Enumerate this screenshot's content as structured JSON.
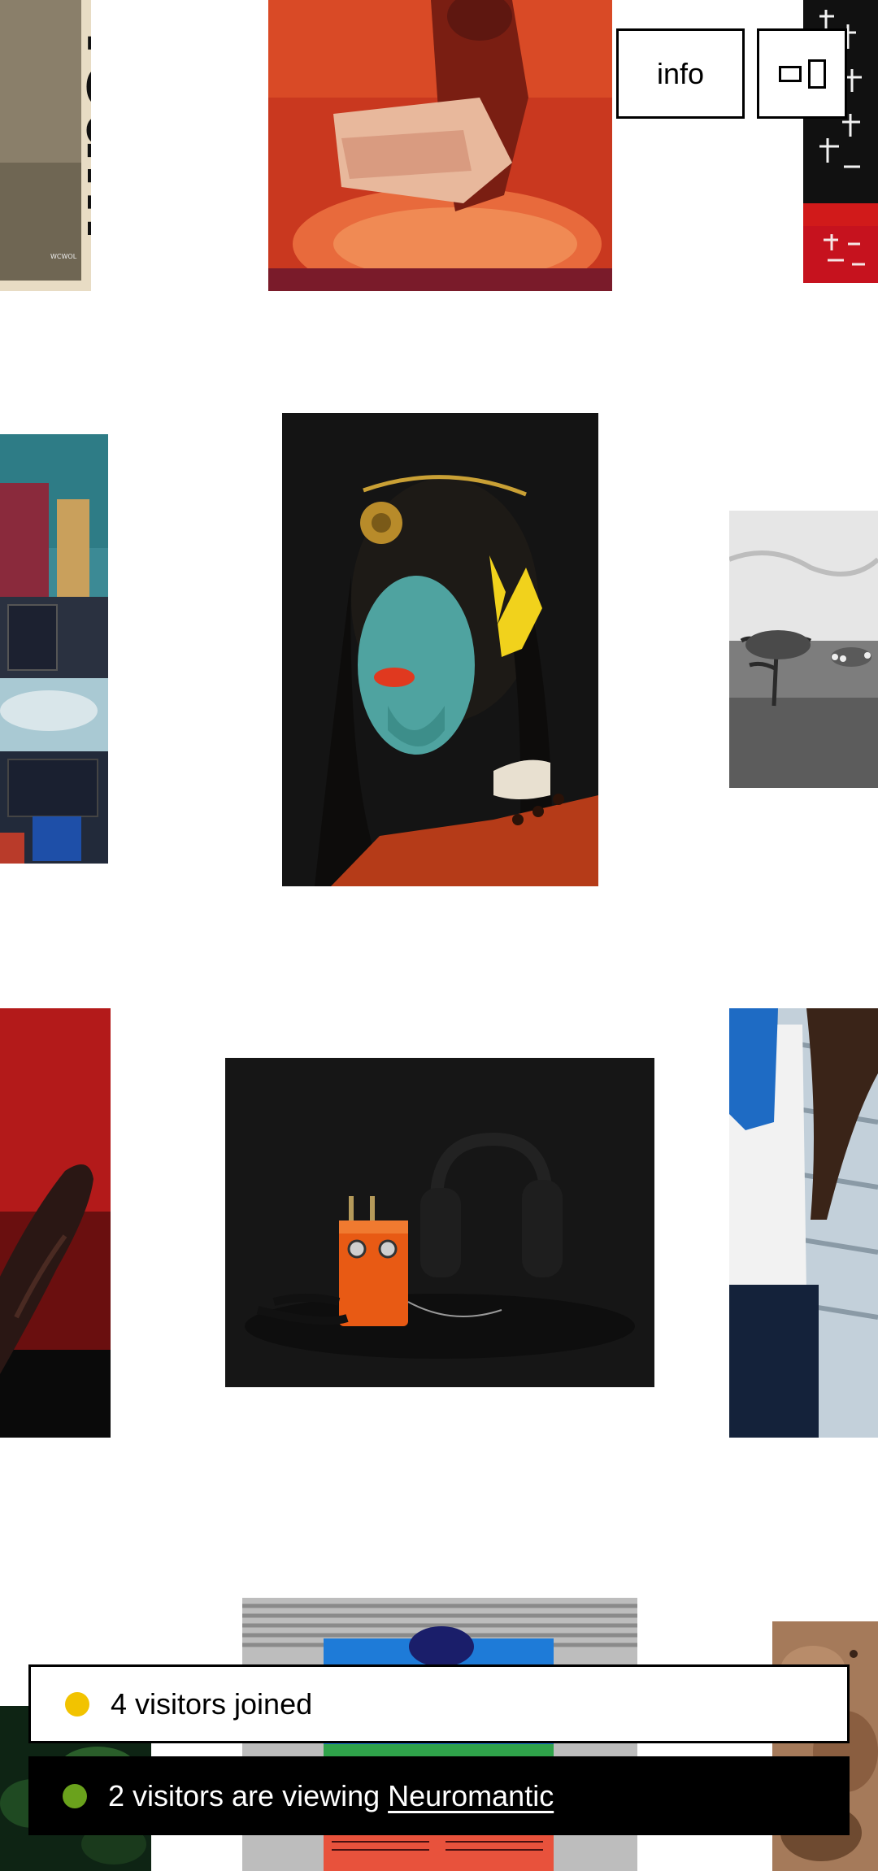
{
  "header": {
    "info_label": "info",
    "layout_toggle_icon": "layout-toggle-icon"
  },
  "tiles": [
    {
      "name": "tile-foam-magazine-cover",
      "logo_text": "foam",
      "small_text": "WCWOL"
    },
    {
      "name": "tile-red-tinted-figure"
    },
    {
      "name": "tile-chinese-calligraphy"
    },
    {
      "name": "tile-textiles-luggage"
    },
    {
      "name": "tile-painted-face-portrait"
    },
    {
      "name": "tile-bw-landscape-tree"
    },
    {
      "name": "tile-red-fabric-hand"
    },
    {
      "name": "tile-orange-pedal-headphones"
    },
    {
      "name": "tile-white-shirt-figure"
    },
    {
      "name": "tile-printed-page-scan"
    },
    {
      "name": "tile-green-foliage"
    },
    {
      "name": "tile-brown-texture"
    }
  ],
  "notifications": {
    "joined": {
      "text": "4 visitors joined",
      "dot_color": "#f2c300"
    },
    "viewing": {
      "text": "2 visitors are viewing",
      "link": "Neuromantic",
      "dot_color": "#6aa21c"
    }
  },
  "colors": {
    "background": "#ffffff",
    "border": "#000000"
  }
}
